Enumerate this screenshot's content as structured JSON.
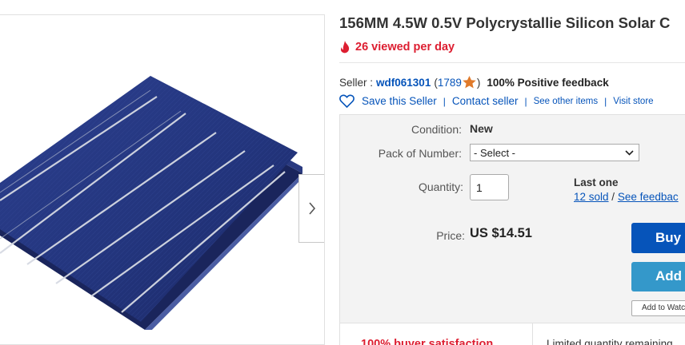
{
  "product": {
    "title": "156MM 4.5W 0.5V Polycrystallie Silicon Solar C",
    "viewed": "26 viewed per day",
    "image_icon": "solar-cell-photo"
  },
  "seller": {
    "label": "Seller :",
    "username": "wdf061301",
    "open_paren": "(",
    "score": "1789",
    "close_paren": ")",
    "positive": "100% Positive feedback",
    "star_color": "#e07a2a"
  },
  "links": {
    "save_seller": "Save this Seller",
    "contact_seller": "Contact seller",
    "other_items": "See other items",
    "visit_store": "Visit store"
  },
  "item": {
    "condition_label": "Condition:",
    "condition_value": "New",
    "pack_label": "Pack of Number:",
    "pack_selected": "- Select -",
    "quantity_label": "Quantity:",
    "quantity_value": "1",
    "last_one": "Last one",
    "sold": "12 sold",
    "slash": " / ",
    "see_feedback": "See feedbac",
    "price_label": "Price:",
    "price_value": "US $14.51"
  },
  "actions": {
    "buy": "Buy",
    "add": "Add",
    "watch": "Add to Watc"
  },
  "bottom": {
    "satisfaction": "100% buyer satisfaction",
    "limited": "Limited quantity remaining"
  },
  "colors": {
    "link": "#0654ba",
    "alert_red": "#dd1e31",
    "buy_button": "#0654ba",
    "add_button": "#3498ca"
  }
}
